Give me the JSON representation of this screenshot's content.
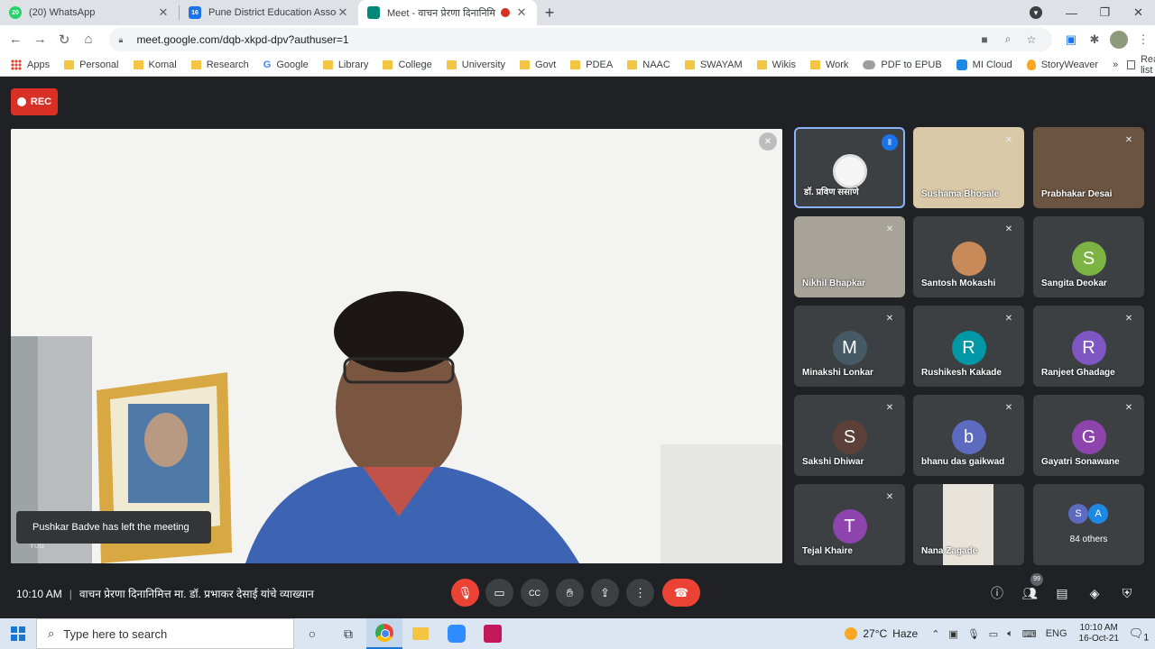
{
  "browser": {
    "tabs": [
      {
        "title": "(20) WhatsApp",
        "favicon": "whatsapp-icon",
        "favicon_text": "20"
      },
      {
        "title": "Pune District Education Associatio",
        "favicon": "calendar-icon",
        "favicon_text": "16"
      },
      {
        "title": "Meet - वाचन प्रेरणा दिनानिमित्त",
        "favicon": "meet-icon",
        "favicon_text": ""
      }
    ],
    "url": "meet.google.com/dqb-xkpd-dpv?authuser=1",
    "bookmarks": [
      {
        "label": "Apps",
        "icon": "apps-grid-icon"
      },
      {
        "label": "Personal",
        "icon": "folder-icon"
      },
      {
        "label": "Komal",
        "icon": "folder-icon"
      },
      {
        "label": "Research",
        "icon": "folder-icon"
      },
      {
        "label": "Google",
        "icon": "google-icon"
      },
      {
        "label": "Library",
        "icon": "folder-icon"
      },
      {
        "label": "College",
        "icon": "folder-icon"
      },
      {
        "label": "University",
        "icon": "folder-icon"
      },
      {
        "label": "Govt",
        "icon": "folder-icon"
      },
      {
        "label": "PDEA",
        "icon": "folder-icon"
      },
      {
        "label": "NAAC",
        "icon": "folder-icon"
      },
      {
        "label": "SWAYAM",
        "icon": "folder-icon"
      },
      {
        "label": "Wikis",
        "icon": "folder-icon"
      },
      {
        "label": "Work",
        "icon": "folder-icon"
      },
      {
        "label": "PDF to EPUB",
        "icon": "pdf-icon"
      },
      {
        "label": "MI Cloud",
        "icon": "cloud-icon"
      },
      {
        "label": "StoryWeaver",
        "icon": "storyweaver-icon"
      }
    ],
    "bookmarks_more": "»",
    "reading_list": "Reading list"
  },
  "meet": {
    "rec_label": "REC",
    "toast": "Pushkar Badve has left the meeting",
    "you_label": "You",
    "participants": [
      {
        "name": "डॉ. प्रविण ससाणे",
        "initial": "",
        "color": "",
        "kind": "photo-circle",
        "speaking": true
      },
      {
        "name": "Sushama Bhosale",
        "initial": "",
        "color": "",
        "kind": "video",
        "speaking": false
      },
      {
        "name": "Prabhakar Desai",
        "initial": "",
        "color": "",
        "kind": "video",
        "speaking": false
      },
      {
        "name": "Nikhil Bhapkar",
        "initial": "",
        "color": "",
        "kind": "video",
        "speaking": false
      },
      {
        "name": "Santosh Mokashi",
        "initial": "",
        "color": "",
        "kind": "photo-circle",
        "speaking": false
      },
      {
        "name": "Sangita Deokar",
        "initial": "S",
        "color": "#7cb342",
        "kind": "avatar",
        "speaking": false
      },
      {
        "name": "Minakshi Lonkar",
        "initial": "M",
        "color": "#455a64",
        "kind": "avatar",
        "speaking": false
      },
      {
        "name": "Rushikesh Kakade",
        "initial": "R",
        "color": "#0097a7",
        "kind": "avatar",
        "speaking": false
      },
      {
        "name": "Ranjeet Ghadage",
        "initial": "R",
        "color": "#7e57c2",
        "kind": "avatar",
        "speaking": false
      },
      {
        "name": "Sakshi Dhiwar",
        "initial": "S",
        "color": "#5d4037",
        "kind": "avatar",
        "speaking": false
      },
      {
        "name": "bhanu das gaikwad",
        "initial": "b",
        "color": "#5c6bc0",
        "kind": "avatar",
        "speaking": false
      },
      {
        "name": "Gayatri Sonawane",
        "initial": "G",
        "color": "#8e44ad",
        "kind": "avatar",
        "speaking": false
      },
      {
        "name": "Tejal Khaire",
        "initial": "T",
        "color": "#8e44ad",
        "kind": "avatar",
        "speaking": false
      },
      {
        "name": "Nana Zagade",
        "initial": "",
        "color": "",
        "kind": "video-narrow",
        "speaking": false
      }
    ],
    "others": {
      "label": "84 others",
      "initials": [
        "S",
        "A"
      ],
      "colors": [
        "#5c6bc0",
        "#1e88e5"
      ]
    },
    "time": "10:10 AM",
    "meeting_title": "वाचन प्रेरणा दिनानिमित्त मा. डॉ. प्रभाकर देसाई यांचे व्याख्यान",
    "people_count": "99"
  },
  "taskbar": {
    "search_placeholder": "Type here to search",
    "weather_temp": "27°C",
    "weather_desc": "Haze",
    "lang": "ENG",
    "clock_time": "10:10 AM",
    "clock_date": "16-Oct-21",
    "notif_count": "1"
  }
}
